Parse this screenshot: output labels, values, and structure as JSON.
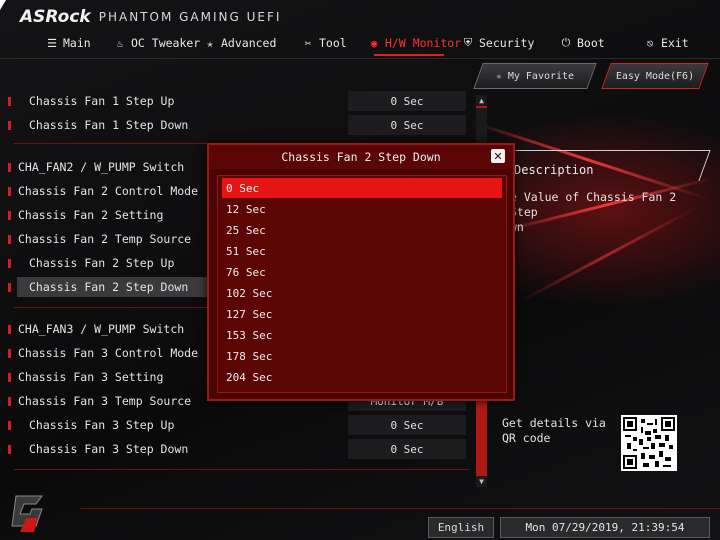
{
  "header": {
    "brand": "ASRock",
    "subtitle": "PHANTOM GAMING UEFI"
  },
  "menu": [
    {
      "label": "Main",
      "icon": "list-icon",
      "active": false
    },
    {
      "label": "OC Tweaker",
      "icon": "flame-icon",
      "active": false
    },
    {
      "label": "Advanced",
      "icon": "star-icon",
      "active": false
    },
    {
      "label": "Tool",
      "icon": "wrench-icon",
      "active": false
    },
    {
      "label": "H/W Monitor",
      "icon": "monitor-icon",
      "active": true
    },
    {
      "label": "Security",
      "icon": "shield-icon",
      "active": false
    },
    {
      "label": "Boot",
      "icon": "power-icon",
      "active": false
    },
    {
      "label": "Exit",
      "icon": "exit-icon",
      "active": false
    }
  ],
  "buttons": {
    "favorite": "My Favorite",
    "easy_mode": "Easy Mode(F6)"
  },
  "settings": [
    {
      "label": "Chassis Fan 1 Step Up",
      "value": "0 Sec",
      "indent": true
    },
    {
      "label": "Chassis Fan 1 Step Down",
      "value": "0 Sec",
      "indent": true
    },
    {
      "label": "CHA_FAN2 / W_PUMP Switch",
      "value": "",
      "indent": false
    },
    {
      "label": "Chassis Fan 2 Control Mode",
      "value": "",
      "indent": false
    },
    {
      "label": "Chassis Fan 2 Setting",
      "value": "",
      "indent": false
    },
    {
      "label": "Chassis Fan 2 Temp Source",
      "value": "",
      "indent": false
    },
    {
      "label": "Chassis Fan 2 Step Up",
      "value": "",
      "indent": true
    },
    {
      "label": "Chassis Fan 2 Step Down",
      "value": "",
      "indent": true,
      "selected": true
    },
    {
      "label": "CHA_FAN3 / W_PUMP Switch",
      "value": "",
      "indent": false
    },
    {
      "label": "Chassis Fan 3 Control Mode",
      "value": "",
      "indent": false
    },
    {
      "label": "Chassis Fan 3 Setting",
      "value": "",
      "indent": false
    },
    {
      "label": "Chassis Fan 3 Temp Source",
      "value": "Monitor M/B",
      "indent": false
    },
    {
      "label": "Chassis Fan 3 Step Up",
      "value": "0 Sec",
      "indent": true
    },
    {
      "label": "Chassis Fan 3 Step Down",
      "value": "0 Sec",
      "indent": true
    }
  ],
  "description": {
    "title": "Description",
    "text": "e Value of Chassis Fan 2 Step\nwn",
    "qr_text": "Get details via QR code"
  },
  "popup": {
    "title": "Chassis Fan 2 Step Down",
    "options": [
      "0 Sec",
      "12 Sec",
      "25 Sec",
      "51 Sec",
      "76 Sec",
      "102 Sec",
      "127 Sec",
      "153 Sec",
      "178 Sec",
      "204 Sec"
    ],
    "selected_index": 0
  },
  "footer": {
    "language": "English",
    "datetime": "Mon 07/29/2019, 21:39:54"
  },
  "colors": {
    "accent": "#e02020",
    "popup_bg": "#4a0404",
    "selected_option": "#e81414"
  }
}
